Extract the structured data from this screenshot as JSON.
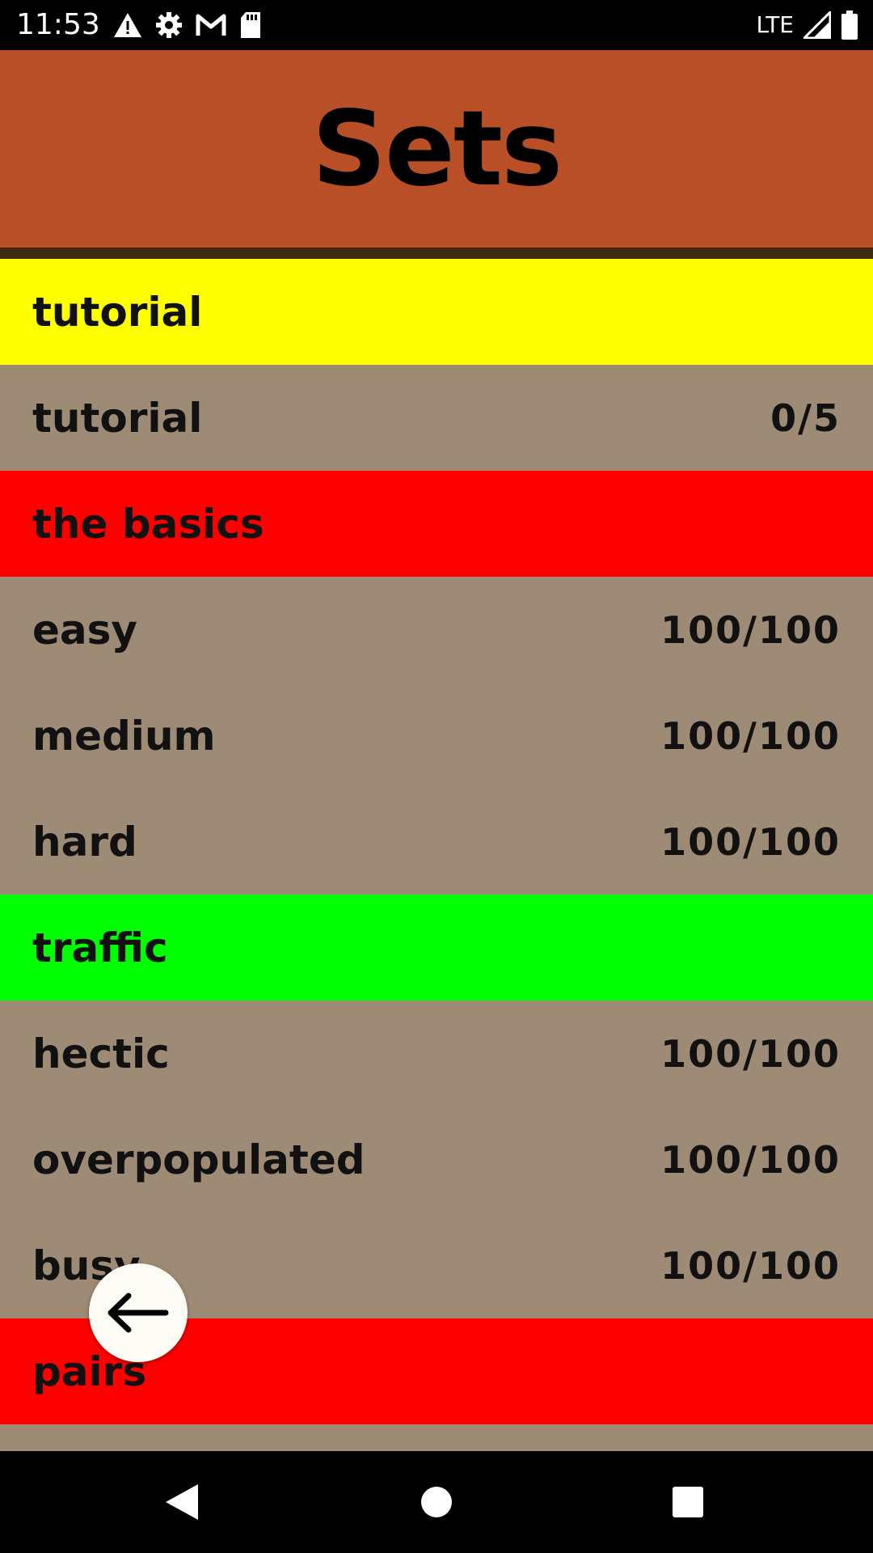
{
  "status_bar": {
    "time": "11:53",
    "network": "LTE",
    "icons_left": [
      "warning-icon",
      "gear-icon",
      "gmail-icon",
      "sd-card-icon"
    ],
    "icons_right": [
      "signal-icon",
      "battery-icon"
    ]
  },
  "header": {
    "title": "Sets",
    "background": "#b84f27",
    "divider_color": "#3e2a14"
  },
  "list": {
    "item_background": "#9e8b76",
    "rows": [
      {
        "type": "category",
        "name": "tutorial",
        "color": "#ffff00"
      },
      {
        "type": "item",
        "name": "tutorial",
        "score": "0/5"
      },
      {
        "type": "category",
        "name": "the basics",
        "color": "#ff0000"
      },
      {
        "type": "item",
        "name": "easy",
        "score": "100/100"
      },
      {
        "type": "item",
        "name": "medium",
        "score": "100/100"
      },
      {
        "type": "item",
        "name": "hard",
        "score": "100/100"
      },
      {
        "type": "category",
        "name": "traffic",
        "color": "#00ff00"
      },
      {
        "type": "item",
        "name": "hectic",
        "score": "100/100"
      },
      {
        "type": "item",
        "name": "overpopulated",
        "score": "100/100"
      },
      {
        "type": "item",
        "name": "busy",
        "score": "100/100"
      },
      {
        "type": "category",
        "name": "pairs",
        "color": "#ff0000"
      }
    ]
  },
  "fab": {
    "icon": "arrow-left-icon"
  },
  "nav_bar": {
    "buttons": [
      "back-triangle-icon",
      "home-circle-icon",
      "recents-square-icon"
    ]
  }
}
